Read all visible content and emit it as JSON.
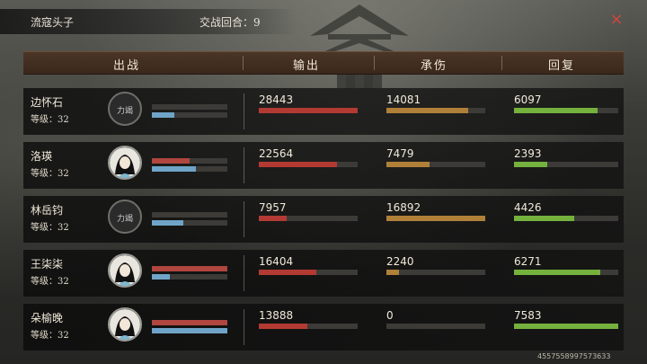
{
  "header": {
    "team_name": "流寇头子",
    "rounds_label": "交战回合：9",
    "close_icon": "×"
  },
  "columns": [
    "出战",
    "输出",
    "承伤",
    "回复"
  ],
  "colors": {
    "output": "#b33a33",
    "damage_taken": "#b08038",
    "heal": "#74b13d",
    "hp": "#b0463f",
    "mp": "#6fa4c8"
  },
  "rows": [
    {
      "name": "边怀石",
      "level": "等级：32",
      "avatar_tag": "力竭",
      "dim": true,
      "hp": 0,
      "mp": 0.3,
      "output": "28443",
      "output_frac": 1.0,
      "taken": "14081",
      "taken_frac": 0.83,
      "heal": "6097",
      "heal_frac": 0.8
    },
    {
      "name": "洛瑛",
      "level": "等级：32",
      "avatar_tag": "",
      "dim": false,
      "hp": 0.5,
      "mp": 0.58,
      "output": "22564",
      "output_frac": 0.79,
      "taken": "7479",
      "taken_frac": 0.44,
      "heal": "2393",
      "heal_frac": 0.32
    },
    {
      "name": "林岳钧",
      "level": "等级：32",
      "avatar_tag": "力竭",
      "dim": true,
      "hp": 0,
      "mp": 0.42,
      "output": "7957",
      "output_frac": 0.28,
      "taken": "16892",
      "taken_frac": 1.0,
      "heal": "4426",
      "heal_frac": 0.58
    },
    {
      "name": "王柒柒",
      "level": "等级：32",
      "avatar_tag": "",
      "dim": false,
      "hp": 1.0,
      "mp": 0.24,
      "output": "16404",
      "output_frac": 0.58,
      "taken": "2240",
      "taken_frac": 0.13,
      "heal": "6271",
      "heal_frac": 0.83
    },
    {
      "name": "朵榆晚",
      "level": "等级：32",
      "avatar_tag": "",
      "dim": false,
      "hp": 1.0,
      "mp": 1.0,
      "output": "13888",
      "output_frac": 0.49,
      "taken": "0",
      "taken_frac": 0.0,
      "heal": "7583",
      "heal_frac": 1.0
    }
  ],
  "footer_id": "4557558997573633"
}
